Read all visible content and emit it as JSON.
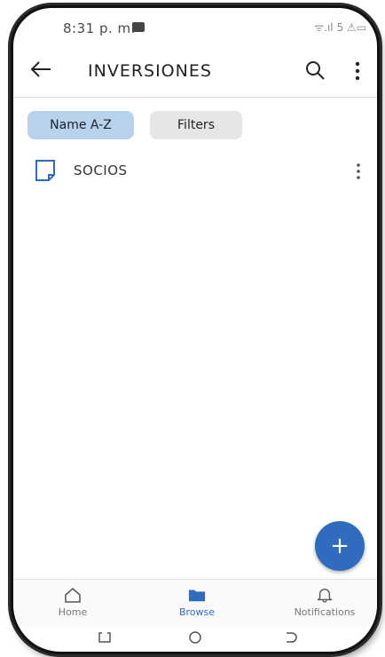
{
  "status_bar": {
    "time": "8:31 p. m.",
    "indicators": "ᯤ.ıl 5 ⚠▭"
  },
  "app_bar": {
    "title": "INVERSIONES",
    "back_icon": "arrow-left-icon",
    "search_icon": "search-icon",
    "more_icon": "more-vert-icon"
  },
  "chips": {
    "sort_label": "Name A-Z",
    "filter_label": "Filters"
  },
  "items": [
    {
      "label": "SOCIOS",
      "icon": "document-icon"
    }
  ],
  "fab": {
    "label": "+"
  },
  "bottom_nav": {
    "home": "Home",
    "browse": "Browse",
    "notifications": "Notifications"
  },
  "colors": {
    "accent": "#2f6cc0",
    "chip_selected": "#b8d2ee",
    "chip": "#e6e6e6"
  }
}
